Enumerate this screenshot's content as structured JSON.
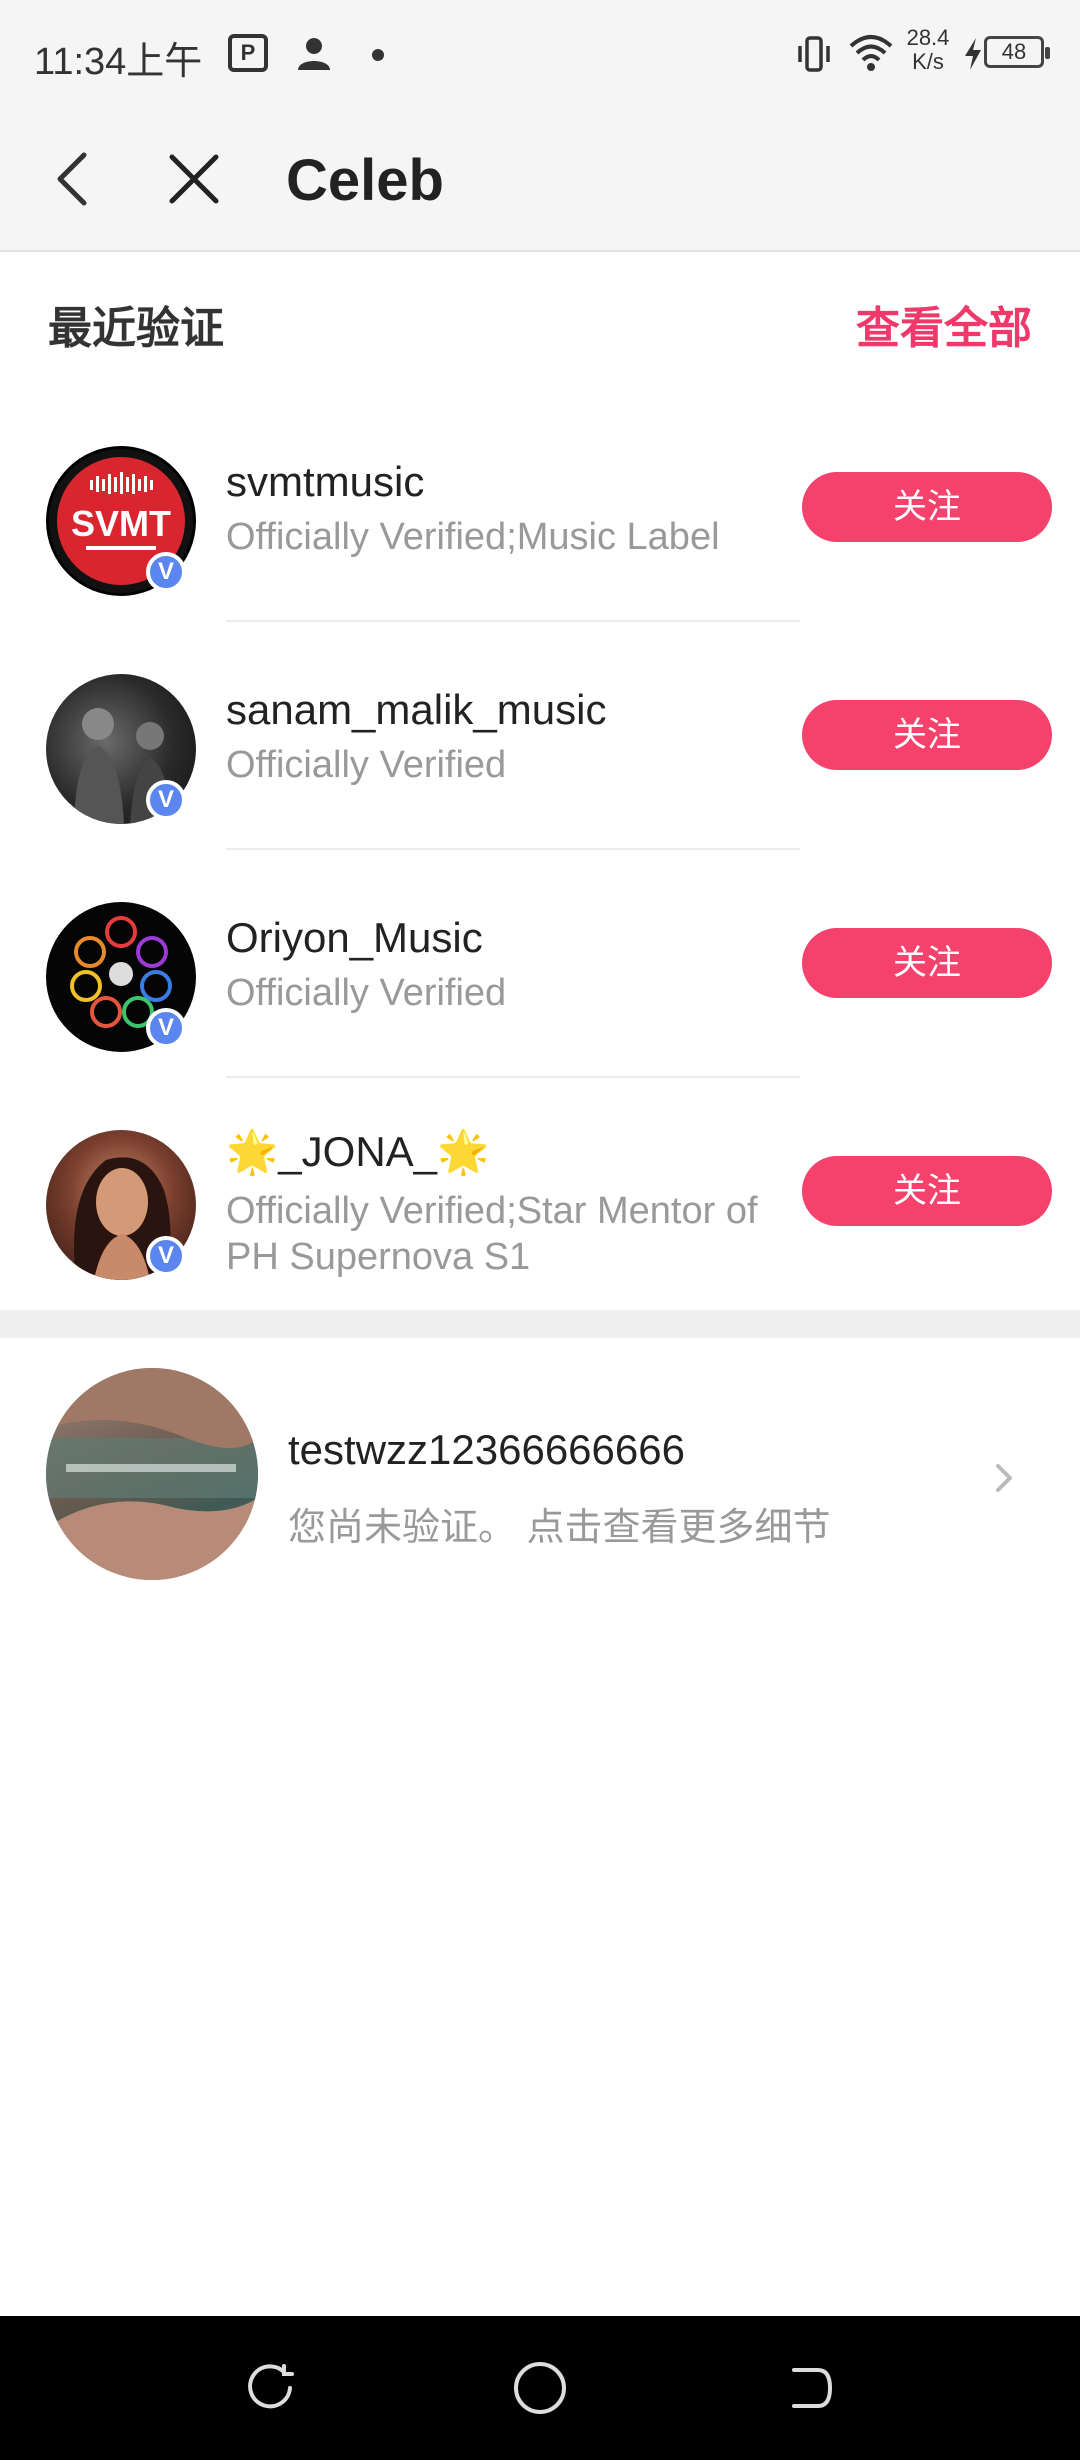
{
  "status_bar": {
    "time": "11:34上午",
    "app_icon_text": "P",
    "net_speed_value": "28.4",
    "net_speed_unit": "K/s",
    "battery": "48",
    "icons": [
      "portrait-app-icon",
      "person-icon",
      "dot-icon",
      "vibrate-icon",
      "wifi-icon",
      "charging-bolt-icon",
      "battery-icon"
    ]
  },
  "nav": {
    "title": "Celeb",
    "icons": [
      "back-arrow-icon",
      "close-icon"
    ]
  },
  "section": {
    "title": "最近验证",
    "view_all": "查看全部"
  },
  "celebs": [
    {
      "name": "svmtmusic",
      "desc": "Officially Verified;Music Label",
      "button": "关注",
      "badge": "V"
    },
    {
      "name": "sanam_malik_music",
      "desc": "Officially Verified",
      "button": "关注",
      "badge": "V"
    },
    {
      "name": "Oriyon_Music",
      "desc": "Officially Verified",
      "button": "关注",
      "badge": "V"
    },
    {
      "name": "🌟_JONA_🌟",
      "desc": "Officially Verified;Star Mentor of PH Supernova S1",
      "button": "关注",
      "badge": "V"
    }
  ],
  "avatar_logo_text": "SVMT",
  "my_account": {
    "name": "testwzz12366666666",
    "status": "您尚未验证。 点击查看更多细节"
  },
  "colors": {
    "accent": "#f0386b",
    "follow_button": "#f5426c",
    "verified_badge": "#5b86f0"
  },
  "system_nav": [
    "recent-apps-icon",
    "home-icon",
    "back-icon"
  ]
}
